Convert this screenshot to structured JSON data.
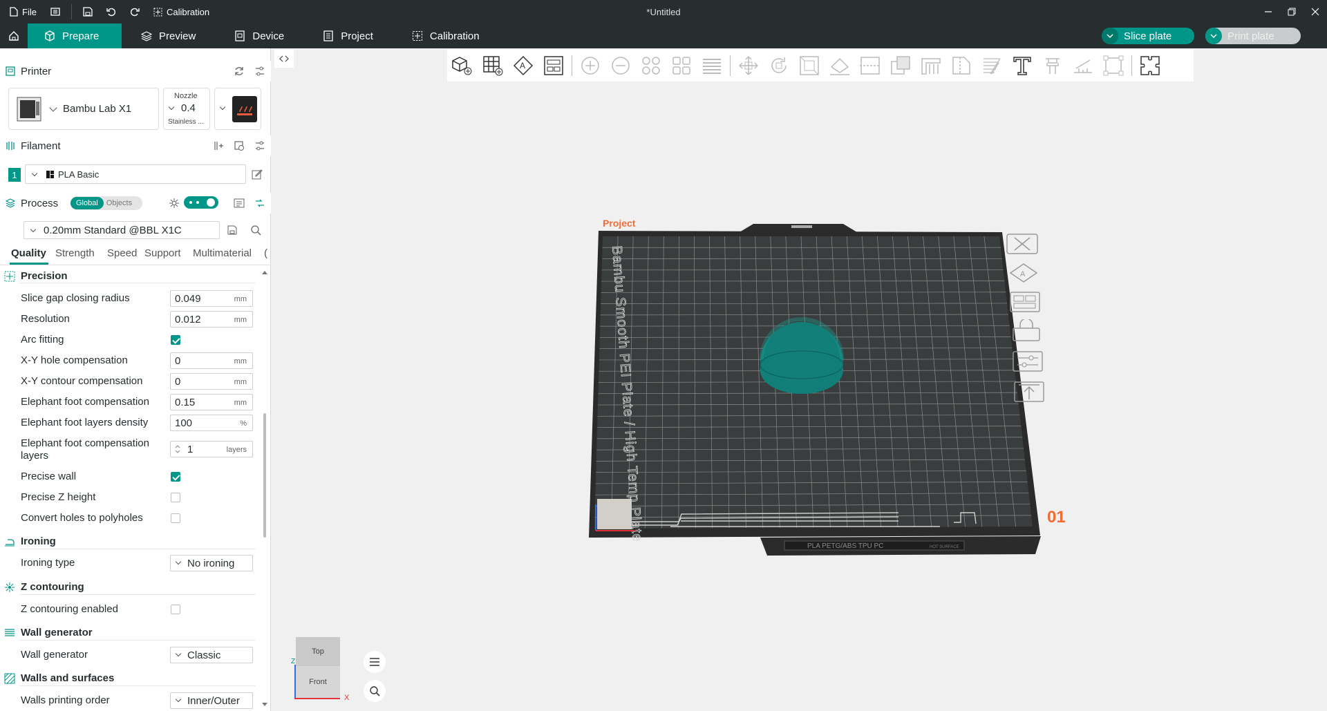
{
  "titlebar": {
    "file_label": "File",
    "calibration_label": "Calibration",
    "doc_title": "*Untitled"
  },
  "tabs": [
    {
      "label": "Prepare",
      "icon": "cube-icon"
    },
    {
      "label": "Preview",
      "icon": "layers-icon"
    },
    {
      "label": "Device",
      "icon": "device-icon"
    },
    {
      "label": "Project",
      "icon": "project-icon"
    },
    {
      "label": "Calibration",
      "icon": "calibration-icon"
    }
  ],
  "actions": {
    "slice_label": "Slice plate",
    "print_label": "Print plate"
  },
  "printer": {
    "section_label": "Printer",
    "name": "Bambu Lab X1",
    "nozzle_caption": "Nozzle",
    "nozzle_value": "0.4",
    "nozzle_type": "Stainless ..."
  },
  "filament": {
    "section_label": "Filament",
    "slot": "1",
    "name": "PLA Basic",
    "color": "#161616"
  },
  "process": {
    "section_label": "Process",
    "toggle_global": "Global",
    "toggle_objects": "Objects",
    "preset": "0.20mm Standard @BBL X1C"
  },
  "quality_tabs": [
    "Quality",
    "Strength",
    "Speed",
    "Support",
    "Multimaterial",
    "("
  ],
  "groups": {
    "precision": "Precision",
    "ironing": "Ironing",
    "z_contouring": "Z contouring",
    "wall_generator": "Wall generator",
    "walls_surfaces": "Walls and surfaces"
  },
  "settings": {
    "slice_gap": {
      "label": "Slice gap closing radius",
      "value": "0.049",
      "unit": "mm"
    },
    "resolution": {
      "label": "Resolution",
      "value": "0.012",
      "unit": "mm"
    },
    "arc_fitting": {
      "label": "Arc fitting",
      "checked": true
    },
    "xy_hole": {
      "label": "X-Y hole compensation",
      "value": "0",
      "unit": "mm"
    },
    "xy_contour": {
      "label": "X-Y contour compensation",
      "value": "0",
      "unit": "mm"
    },
    "elephant_foot": {
      "label": "Elephant foot compensation",
      "value": "0.15",
      "unit": "mm"
    },
    "elephant_density": {
      "label": "Elephant foot layers density",
      "value": "100",
      "unit": "%"
    },
    "elephant_layers_l1": "Elephant foot compensation",
    "elephant_layers_l2": "layers",
    "elephant_layers": {
      "value": "1",
      "unit": "layers"
    },
    "precise_wall": {
      "label": "Precise wall",
      "checked": true
    },
    "precise_z": {
      "label": "Precise Z height",
      "checked": false
    },
    "convert_holes": {
      "label": "Convert holes to polyholes",
      "checked": false
    },
    "ironing_type": {
      "label": "Ironing type",
      "value": "No ironing"
    },
    "z_contouring_enabled": {
      "label": "Z contouring enabled",
      "checked": false
    },
    "wall_generator": {
      "label": "Wall generator",
      "value": "Classic"
    },
    "walls_order": {
      "label": "Walls printing order",
      "value": "Inner/Outer"
    }
  },
  "plate": {
    "project_label": "Project",
    "plate_text": "Bambu Smooth PEI Plate / High Temp Plate",
    "plate_number": "01",
    "bottom_text": "PLA PETG/ABS TPU PC",
    "surface_text": "HOT SURFACE"
  },
  "view_cube": {
    "top": "Top",
    "front": "Front",
    "axis_z": "Z",
    "axis_x": "X"
  },
  "colors": {
    "accent": "#009688",
    "dark": "#262e30",
    "plate_number": "#ef6c34",
    "object": "#0e7d77"
  }
}
